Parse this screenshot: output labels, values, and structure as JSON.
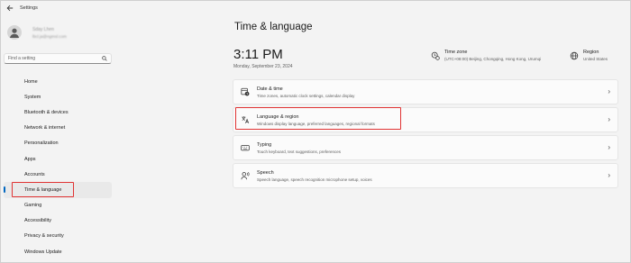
{
  "window": {
    "title": "Settings"
  },
  "user": {
    "name": "Sday Lhen",
    "email": "lbcl.ja@ngmsl.com"
  },
  "search": {
    "placeholder": "Find a setting"
  },
  "nav": {
    "items": [
      {
        "label": "Home"
      },
      {
        "label": "System"
      },
      {
        "label": "Bluetooth & devices"
      },
      {
        "label": "Network & internet"
      },
      {
        "label": "Personalization"
      },
      {
        "label": "Apps"
      },
      {
        "label": "Accounts"
      },
      {
        "label": "Time & language",
        "active": true
      },
      {
        "label": "Gaming"
      },
      {
        "label": "Accessibility"
      },
      {
        "label": "Privacy & security"
      },
      {
        "label": "Windows Update"
      }
    ]
  },
  "page": {
    "title": "Time & language",
    "time": "3:11 PM",
    "date": "Monday, September 23, 2024",
    "timezone": {
      "label": "Time zone",
      "value": "(UTC+08:00) Beijing, Chongqing, Hong Kong, Urumqi"
    },
    "region": {
      "label": "Region",
      "value": "United States"
    }
  },
  "cards": [
    {
      "title": "Date & time",
      "desc": "Time zones, automatic clock settings, calendar display",
      "icon": "clock-icon"
    },
    {
      "title": "Language & region",
      "desc": "Windows display language, preferred languages, regional formats",
      "icon": "language-icon"
    },
    {
      "title": "Typing",
      "desc": "Touch keyboard, text suggestions, preferences",
      "icon": "keyboard-icon"
    },
    {
      "title": "Speech",
      "desc": "Speech language, speech recognition microphone setup, voices",
      "icon": "speech-icon"
    }
  ],
  "colors": {
    "accent": "#0067c0",
    "highlight": "#e03333",
    "background": "#f3f3f3"
  }
}
